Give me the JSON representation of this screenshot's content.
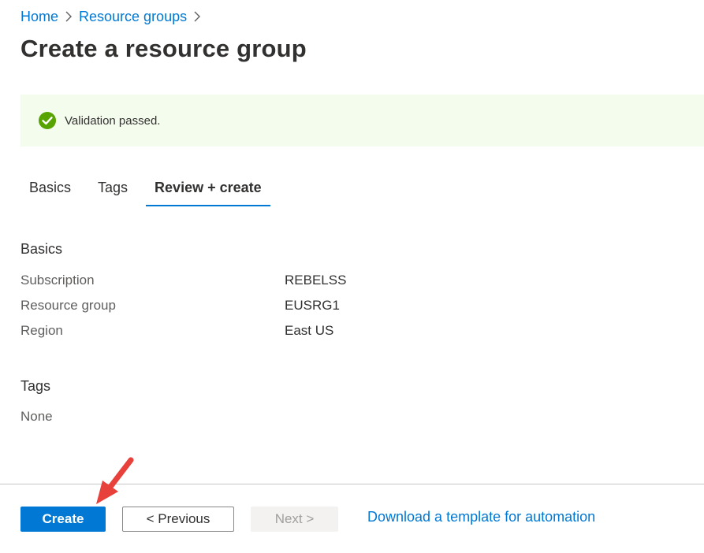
{
  "breadcrumb": {
    "items": [
      {
        "label": "Home"
      },
      {
        "label": "Resource groups"
      }
    ]
  },
  "page": {
    "title": "Create a resource group"
  },
  "validation": {
    "message": "Validation passed.",
    "color": "#57a300"
  },
  "tabs": [
    {
      "label": "Basics",
      "active": false
    },
    {
      "label": "Tags",
      "active": false
    },
    {
      "label": "Review + create",
      "active": true
    }
  ],
  "summary": {
    "basics_heading": "Basics",
    "rows": [
      {
        "label": "Subscription",
        "value": "REBELSS"
      },
      {
        "label": "Resource group",
        "value": "EUSRG1"
      },
      {
        "label": "Region",
        "value": "East US"
      }
    ],
    "tags_heading": "Tags",
    "tags_value": "None"
  },
  "footer": {
    "create_label": "Create",
    "previous_label": "< Previous",
    "next_label": "Next >",
    "download_label": "Download a template for automation"
  },
  "colors": {
    "accent": "#0078d4",
    "annotation_arrow": "#e8403a"
  }
}
